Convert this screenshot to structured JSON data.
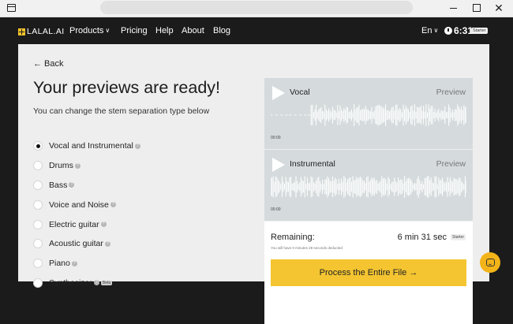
{
  "nav": {
    "logo": "LALAL.AI",
    "items": [
      "Products",
      "Pricing",
      "Help",
      "About",
      "Blog"
    ],
    "language": "En",
    "time": "6:31",
    "plan": "Starter"
  },
  "main": {
    "back": "← Back",
    "title": "Your previews are ready!",
    "subtitle": "You can change the stem separation type below",
    "options": [
      {
        "label": "Vocal and Instrumental",
        "selected": true
      },
      {
        "label": "Drums",
        "selected": false
      },
      {
        "label": "Bass",
        "selected": false
      },
      {
        "label": "Voice and Noise",
        "selected": false
      },
      {
        "label": "Electric guitar",
        "selected": false
      },
      {
        "label": "Acoustic guitar",
        "selected": false
      },
      {
        "label": "Piano",
        "selected": false
      },
      {
        "label": "Synthesizer",
        "selected": false,
        "badge": "Beta"
      }
    ]
  },
  "tracks": [
    {
      "name": "Vocal",
      "preview": "Preview",
      "time": "00:00"
    },
    {
      "name": "Instrumental",
      "preview": "Preview",
      "time": "00:00"
    }
  ],
  "remaining": {
    "label": "Remaining:",
    "value": "6 min 31 sec",
    "badge": "Starter",
    "note": "You will have 0 minutes 28 seconds deducted",
    "button": "Process the Entire File →"
  },
  "colors": {
    "nav_bg": "#1b1b1b",
    "accent": "#f4c531",
    "track_bg": "#d5dbdd"
  },
  "icons": {
    "window": "window-icon",
    "minimize": "minimize-icon",
    "maximize": "maximize-icon",
    "close": "close-icon",
    "play": "play-icon",
    "info": "info-icon",
    "chat": "chat-icon"
  }
}
